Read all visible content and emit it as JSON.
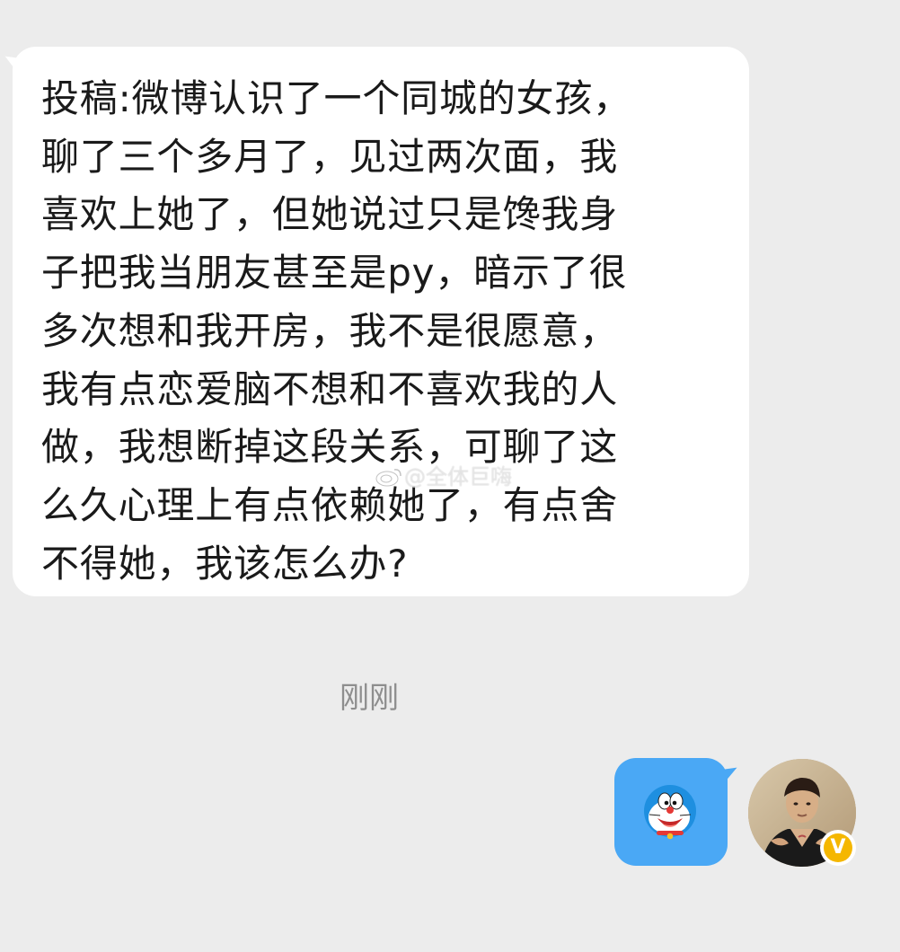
{
  "conversation": {
    "incoming_message": {
      "text": "投稿:微博认识了一个同城的女孩，\n聊了三个多月了，见过两次面，我\n喜欢上她了，但她说过只是馋我身\n子把我当朋友甚至是py，暗示了很\n多次想和我开房，我不是很愿意，\n我有点恋爱脑不想和不喜欢我的人\n做，我想断掉这段关系，可聊了这\n么久心理上有点依赖她了，有点舍\n不得她，我该怎么办?"
    },
    "timestamp": "刚刚",
    "outgoing_message": {
      "sticker_icon": "doraemon-sticker-icon"
    },
    "user": {
      "avatar_icon": "user-avatar",
      "verified_badge_text": "V"
    },
    "watermark": {
      "text": "@全体巨嗨",
      "icon": "weibo-icon"
    }
  },
  "colors": {
    "background": "#ececec",
    "incoming_bubble": "#ffffff",
    "outgoing_bubble": "#4aa8f5",
    "badge": "#f5b700",
    "timestamp": "#8e8e8e"
  }
}
